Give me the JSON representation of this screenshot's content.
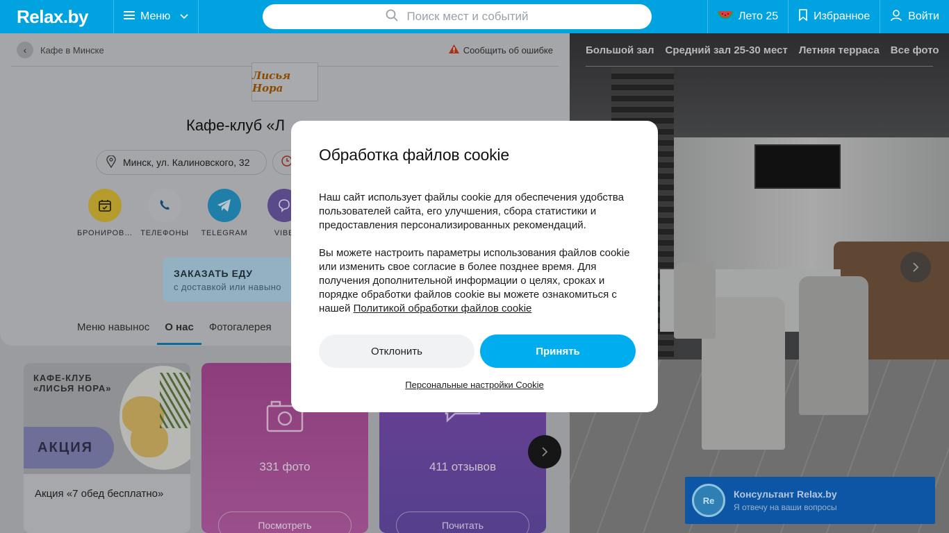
{
  "header": {
    "logo": "Relax.by",
    "menu_label": "Меню",
    "search_placeholder": "Поиск мест и событий",
    "summer_label": "Лето 25",
    "favorites_label": "Избранное",
    "login_label": "Войти"
  },
  "venue": {
    "breadcrumb": "Кафе в Минске",
    "report_label": "Сообщить об ошибке",
    "logo_text": "Лисья Нора",
    "title": "Кафе-клуб «Л",
    "address": "Минск, ул. Калиновского, 32",
    "actions": [
      {
        "label": "БРОНИРОВ…",
        "icon": "calendar-icon",
        "color": "#b59a2c"
      },
      {
        "label": "ТЕЛЕФОНЫ",
        "icon": "phone-icon",
        "color": "#a7a9ac"
      },
      {
        "label": "TELEGRAM",
        "icon": "telegram-icon",
        "color": "#1f7fa8"
      },
      {
        "label": "VIBE",
        "icon": "viber-icon",
        "color": "#5b4a8a"
      }
    ],
    "order_food": {
      "title": "ЗАКАЗАТЬ ЕДУ",
      "subtitle": "с доставкой или навыно"
    },
    "tabs": [
      "Меню навынос",
      "О нас",
      "Фотогалерея"
    ],
    "active_tab": "О нас"
  },
  "tiles": {
    "promo": {
      "header_line1": "КАФЕ-КЛУБ",
      "header_line2": "«ЛИСЬЯ НОРА»",
      "badge": "АКЦИЯ",
      "text": "Акция «7 обед бесплатно»"
    },
    "photos": {
      "count": "331 фото",
      "button": "Посмотреть"
    },
    "reviews": {
      "count": "411 отзывов",
      "button": "Почитать"
    }
  },
  "gallery": {
    "tabs": [
      "Большой зал",
      "Средний зал 25-30 мест",
      "Летняя терраса",
      "Все фото"
    ]
  },
  "consultant": {
    "avatar": "Re",
    "title": "Консультант Relax.by",
    "subtitle": "Я отвечу на ваши вопросы"
  },
  "cookie_modal": {
    "title": "Обработка файлов cookie",
    "paragraph1": "Наш сайт использует файлы cookie для обеспечения удобства пользователей сайта, его улучшения, сбора статистики и предоставления персонализированных рекомендаций.",
    "paragraph2": "Вы можете настроить параметры использования файлов cookie или изменить свое согласие в более позднее время. Для получения дополнительной информации о целях, сроках и порядке обработки файлов cookie вы можете ознакомиться с нашей ",
    "policy_link": "Политикой обработки файлов cookie",
    "decline_label": "Отклонить",
    "accept_label": "Принять",
    "settings_link": "Персональные настройки Cookie"
  },
  "colors": {
    "brand": "#00a3e0",
    "accept": "#00aeef",
    "consultant": "#0d56a6"
  }
}
